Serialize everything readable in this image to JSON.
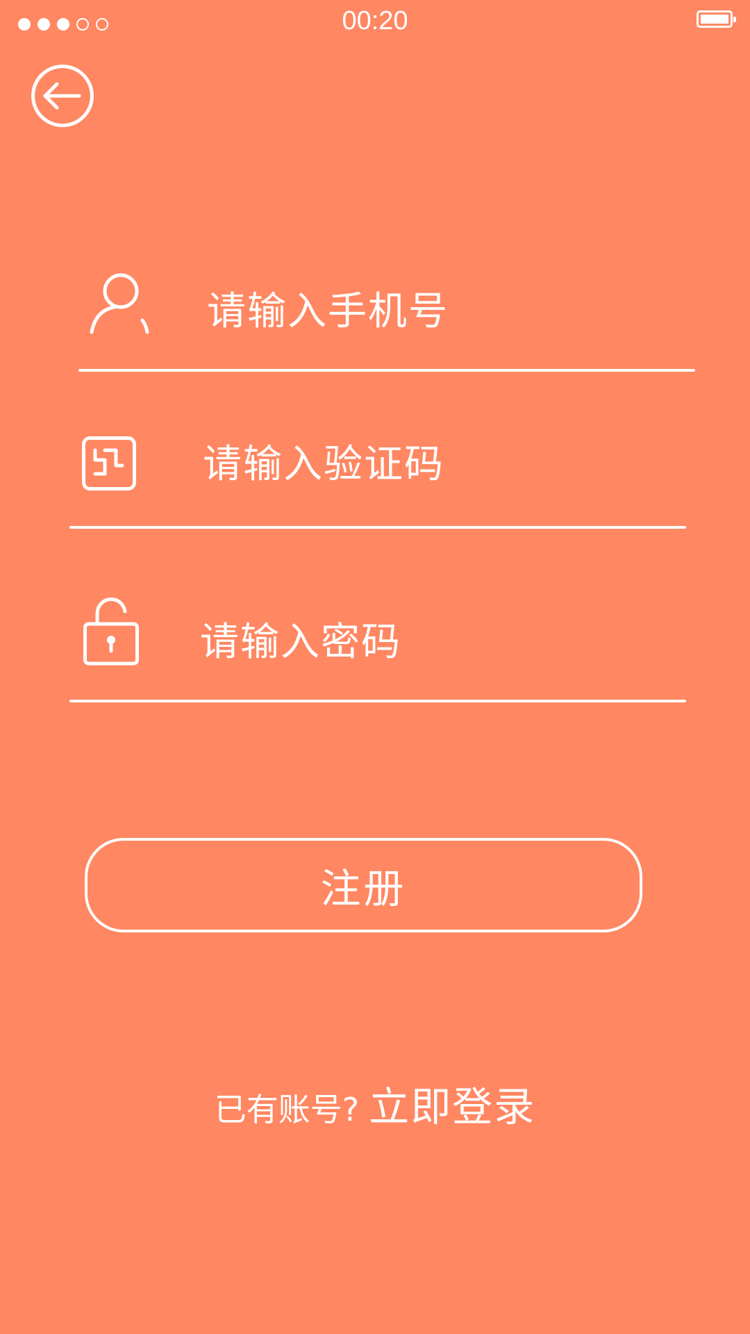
{
  "status_bar": {
    "time": "00:20",
    "signal_filled": 3,
    "signal_total": 5,
    "battery_level": 1.0
  },
  "nav": {
    "back_icon": "arrow-left-circle-icon"
  },
  "form": {
    "phone": {
      "icon": "user-icon",
      "placeholder": "请输入手机号",
      "value": ""
    },
    "code": {
      "icon": "verification-code-icon",
      "placeholder": "请输入验证码",
      "value": ""
    },
    "password": {
      "icon": "lock-icon",
      "placeholder": "请输入密码",
      "value": ""
    },
    "submit_label": "注册"
  },
  "footer": {
    "question": "已有账号?",
    "login_label": "立即登录"
  },
  "colors": {
    "background": "#FF8762",
    "foreground": "#FFFFFF"
  }
}
